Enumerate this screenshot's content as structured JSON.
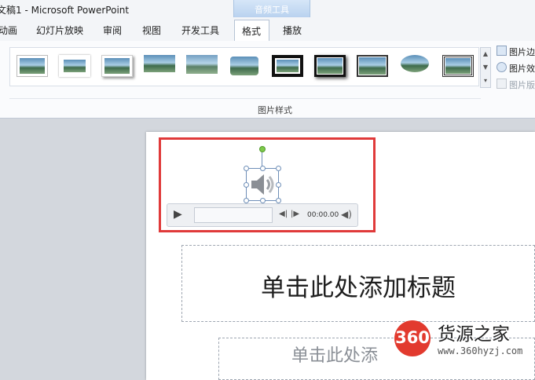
{
  "window": {
    "title": "文稿1 - Microsoft PowerPoint",
    "context_tab_group": "音频工具"
  },
  "tabs": [
    {
      "label": "动画"
    },
    {
      "label": "幻灯片放映"
    },
    {
      "label": "审阅"
    },
    {
      "label": "视图"
    },
    {
      "label": "开发工具"
    },
    {
      "label": "格式",
      "active": true
    },
    {
      "label": "播放"
    }
  ],
  "ribbon": {
    "group_label": "图片样式",
    "gallery_styles": [
      {
        "icon": "picture-style-simple-frame"
      },
      {
        "icon": "picture-style-soft-frame"
      },
      {
        "icon": "picture-style-shadow"
      },
      {
        "icon": "picture-style-reflection"
      },
      {
        "icon": "picture-style-soft-edge"
      },
      {
        "icon": "picture-style-rounded"
      },
      {
        "icon": "picture-style-thick-black-frame"
      },
      {
        "icon": "picture-style-black-shadow"
      },
      {
        "icon": "picture-style-thin-frame"
      },
      {
        "icon": "picture-style-oval"
      },
      {
        "icon": "picture-style-double-frame"
      }
    ],
    "side_items": [
      {
        "label": "图片边",
        "icon": "pencil-icon",
        "disabled": false
      },
      {
        "label": "图片效",
        "icon": "effects-icon",
        "disabled": false
      },
      {
        "label": "图片版",
        "icon": "layout-icon",
        "disabled": true
      }
    ]
  },
  "player": {
    "time": "00:00.00"
  },
  "slide": {
    "title_placeholder": "单击此处添加标题",
    "subtitle_placeholder": "单击此处添"
  },
  "watermark": {
    "logo_number": "360",
    "site_name": "货源之家",
    "url": "www.360hyzj.com"
  },
  "colors": {
    "highlight": "#e03a3a",
    "context_tab": "#b9d2ef",
    "logo": "#e23a2e"
  }
}
